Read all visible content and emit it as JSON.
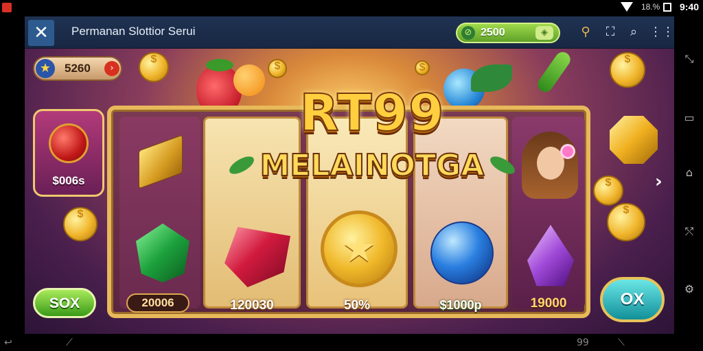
{
  "status_bar": {
    "battery_percent": "18.%",
    "clock": "9:40"
  },
  "window": {
    "title": "Permanan Slottior Serui",
    "close_glyph": "✕",
    "coins": "2500"
  },
  "game": {
    "score": "5260",
    "bonus_value": "$006s",
    "logo_line1": "RT99",
    "logo_line2": "MELAINOTGA",
    "reels": [
      {
        "symbol": "gold-bar / emerald",
        "label": "20006"
      },
      {
        "symbol": "ruby",
        "label": "120030"
      },
      {
        "symbol": "gold-star-medal",
        "label": "50%"
      },
      {
        "symbol": "sapphire",
        "label": "$1000p"
      },
      {
        "symbol": "amethyst / lady",
        "label": "19000"
      }
    ],
    "left_button": "SOX",
    "right_button": "OX"
  },
  "bottom_nav": {
    "right_text": "99"
  },
  "colors": {
    "titlebar": "#1f3252",
    "accent_gold": "#e8b95a",
    "coin_pill": "#7fbf3a",
    "spin_button": "#12909a"
  }
}
